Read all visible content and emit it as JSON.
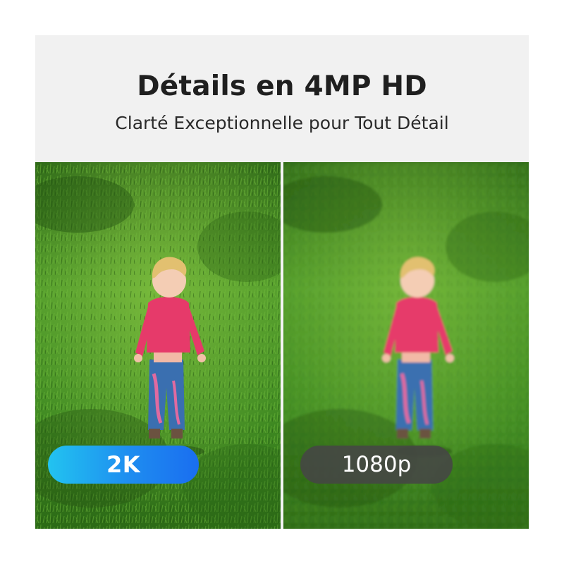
{
  "header": {
    "title": "Détails en 4MP HD",
    "subtitle": "Clarté Exceptionnelle pour Tout Détail"
  },
  "comparison": {
    "left": {
      "badge_label": "2K",
      "image": "child-in-grass-sharp"
    },
    "right": {
      "badge_label": "1080p",
      "image": "child-in-grass-blurred"
    }
  },
  "colors": {
    "header_bg": "#f1f1f1",
    "title": "#1f1f1f",
    "badge_2k_start": "#22c3f0",
    "badge_2k_end": "#1a6ef0",
    "badge_1080p": "#464646",
    "grass": "#3f8a22"
  }
}
